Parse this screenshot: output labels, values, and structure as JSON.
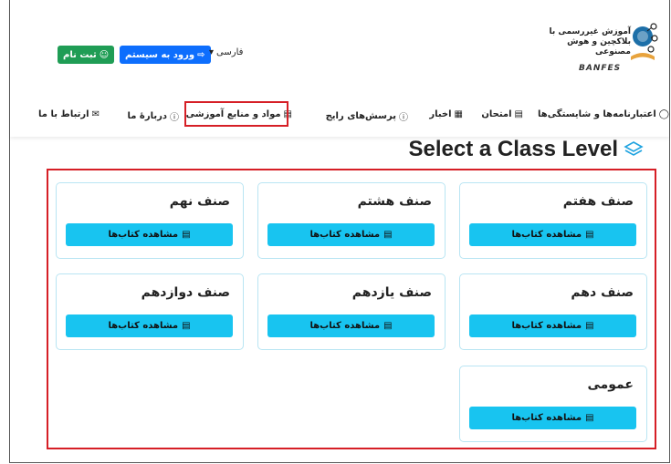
{
  "header": {
    "register_label": "ثبت نام",
    "login_label": "ورود به سیستم",
    "language_label": "فارسی",
    "logo_line1": "آموزش غیررسمی با",
    "logo_line2": "بلاکچین و هوش",
    "logo_line3": "مصنوعی",
    "logo_brand": "BANFES"
  },
  "nav": {
    "items": [
      {
        "label": "اعتبارنامه‌ها و شایستگی‌ها",
        "icon": "bulb-icon"
      },
      {
        "label": "امتحان",
        "icon": "clipboard-icon"
      },
      {
        "label": "اخبار",
        "icon": "newspaper-icon"
      },
      {
        "label": "پرسش‌های رایج",
        "icon": "question-icon"
      },
      {
        "label": "مواد و منابع آموزشی",
        "icon": "book-icon"
      },
      {
        "label": "دربارهٔ ما",
        "icon": "info-icon"
      },
      {
        "label": "ارتباط با ما",
        "icon": "mail-icon"
      }
    ]
  },
  "main": {
    "title": "Select a Class Level",
    "view_books_label": "مشاهده کتاب‌ها",
    "classes": [
      {
        "name": "صنف هفتم"
      },
      {
        "name": "صنف هشتم"
      },
      {
        "name": "صنف نهم"
      },
      {
        "name": "صنف دهم"
      },
      {
        "name": "صنف یازدهم"
      },
      {
        "name": "صنف دوازدهم"
      },
      {
        "name": "عمومی"
      }
    ]
  },
  "colors": {
    "accent": "#18c4f0",
    "login": "#0d6efd",
    "register": "#1f9d55",
    "highlight": "#d61f26"
  }
}
